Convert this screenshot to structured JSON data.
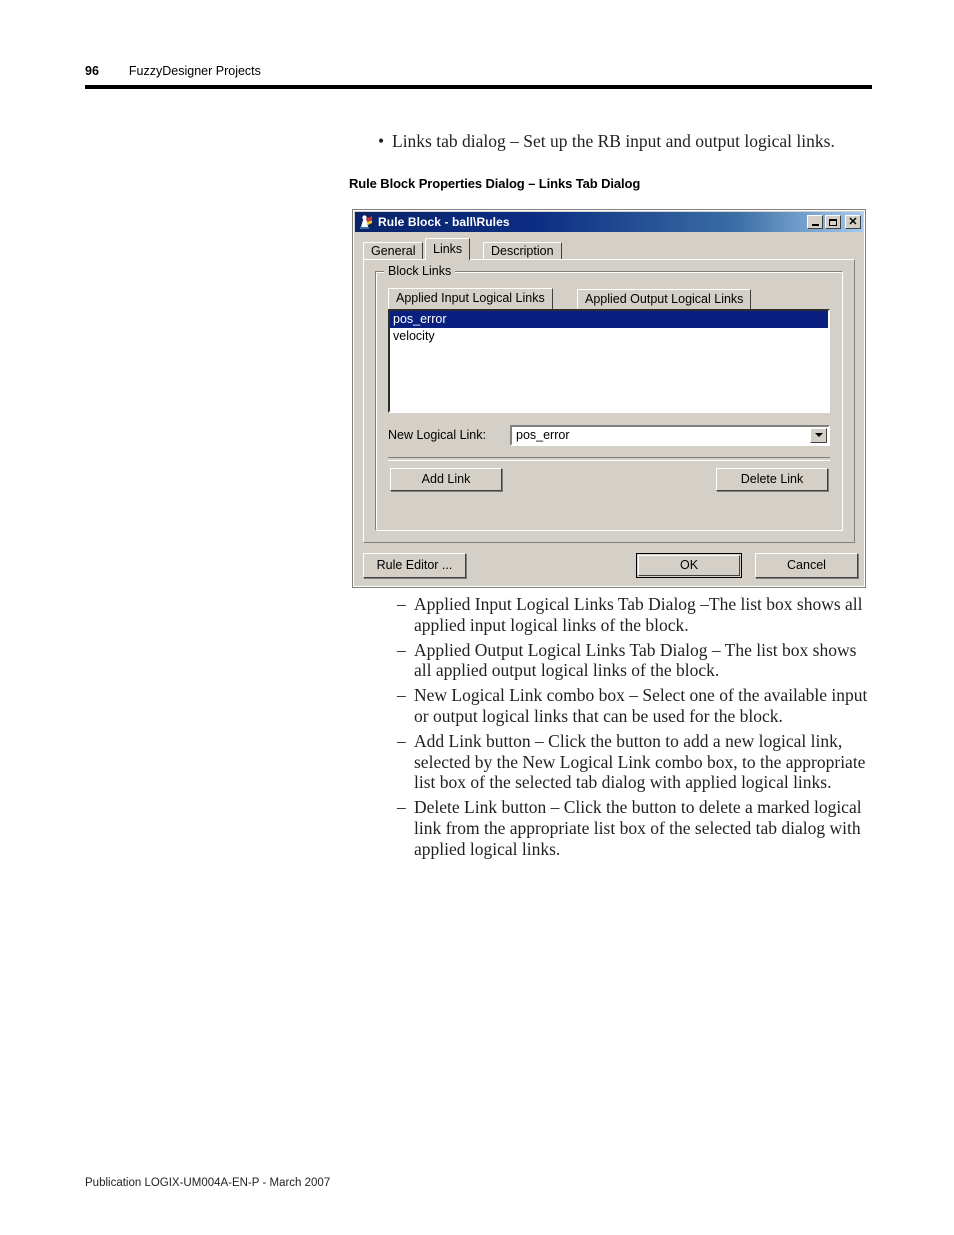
{
  "page": {
    "number": "96",
    "running_head": "FuzzyDesigner Projects",
    "footer": "Publication LOGIX-UM004A-EN-P - March 2007"
  },
  "intro": {
    "bullet": "Links tab dialog – Set up the RB input and output logical links.",
    "bullet_marker": "•",
    "section_heading": "Rule Block Properties Dialog – Links Tab Dialog"
  },
  "dialog": {
    "title": "Rule Block - ball\\Rules",
    "icon": "app-icon",
    "window_buttons": [
      {
        "name": "minimize",
        "glyph": "_"
      },
      {
        "name": "maximize",
        "glyph": "□"
      },
      {
        "name": "close",
        "glyph": "✕"
      }
    ],
    "tabs": [
      {
        "label": "General",
        "active": false
      },
      {
        "label": "Links",
        "active": true
      },
      {
        "label": "Description",
        "active": false
      }
    ],
    "group": {
      "title": "Block Links",
      "inner_tabs": [
        {
          "label": "Applied Input Logical Links",
          "active": true
        },
        {
          "label": "Applied Output Logical Links",
          "active": false
        }
      ],
      "list_items": [
        {
          "label": "pos_error",
          "selected": true
        },
        {
          "label": "velocity",
          "selected": false
        }
      ],
      "combo": {
        "label": "New Logical Link:",
        "value": "pos_error",
        "arrow": "chevron-down-icon"
      },
      "add_link_label": "Add Link",
      "delete_link_label": "Delete Link"
    },
    "footer_buttons": {
      "rule_editor": "Rule Editor ...",
      "ok": "OK",
      "cancel": "Cancel"
    },
    "colors": {
      "face": "#d4d0c8",
      "title_start": "#0a246a",
      "title_end": "#a6caf0",
      "selection": "#0a2080"
    }
  },
  "descriptions": [
    {
      "marker": "–",
      "text": "Applied Input Logical Links Tab Dialog –The list box shows all applied input logical links of the block."
    },
    {
      "marker": "–",
      "text": "Applied Output Logical Links Tab Dialog – The list box shows all applied output logical links of the block."
    },
    {
      "marker": "–",
      "text": "New Logical Link combo box – Select one of the available input or output logical links that can be used for the block."
    },
    {
      "marker": "–",
      "text": "Add Link button – Click the button to add a new logical link, selected by the New Logical Link combo box, to the appropriate list box of the selected tab dialog with applied logical links."
    },
    {
      "marker": "–",
      "text": "Delete Link button – Click the button to delete a marked logical link from the appropriate list box of the selected tab dialog with applied logical links."
    }
  ]
}
